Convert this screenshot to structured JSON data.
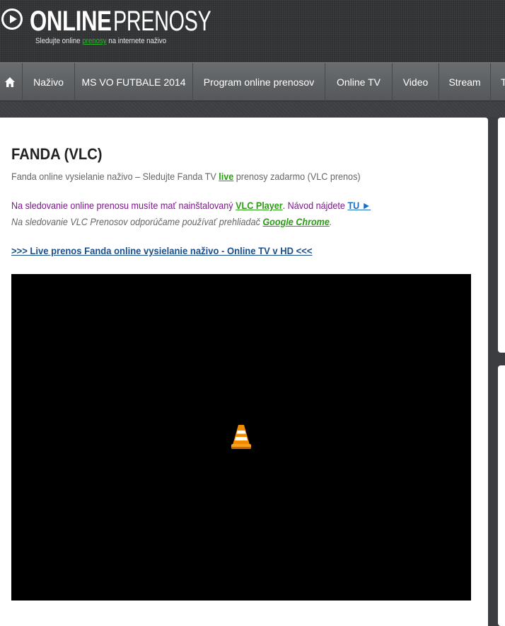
{
  "header": {
    "logo_bold": "ONLINE",
    "logo_light": "PRENOSY",
    "tagline_pre": "Sledujte online ",
    "tagline_link": "prenosy",
    "tagline_post": " na internete naživo"
  },
  "nav": {
    "home_icon": "home-icon",
    "items": [
      {
        "label": "Naživo"
      },
      {
        "label": "MS VO FUTBALE 2014"
      },
      {
        "label": "Program online prenosov"
      },
      {
        "label": "Online TV"
      },
      {
        "label": "Video"
      },
      {
        "label": "Stream"
      },
      {
        "label": "T"
      }
    ]
  },
  "main": {
    "title": "FANDA (VLC)",
    "subtitle_pre": "Fanda online vysielanie naživo – Sledujte Fanda TV ",
    "subtitle_link": "live",
    "subtitle_post": " prenosy zadarmo (VLC prenos)",
    "info1_pre": "Na sledovanie online prenosu musíte mať nainštalovaný ",
    "info1_link": "VLC Player",
    "info1_mid": ". Návod nájdete ",
    "info1_link2": "TU ►",
    "info2_pre": "Na sledovanie VLC Prenosov odporúčame používať prehliadač ",
    "info2_link": "Google Chrome",
    "info2_post": ".",
    "live_link": ">>> Live prenos Fanda online vysielanie naživo - Online TV v HD <<<"
  },
  "player": {
    "icon": "vlc-cone-icon"
  },
  "colors": {
    "header_bg": "#2f3133",
    "nav_bg": "#5f6265",
    "link_green": "#2a9d12",
    "link_blue": "#1a6fc4",
    "info_purple": "#7a1a8a",
    "vlc_orange": "#f08a00"
  }
}
